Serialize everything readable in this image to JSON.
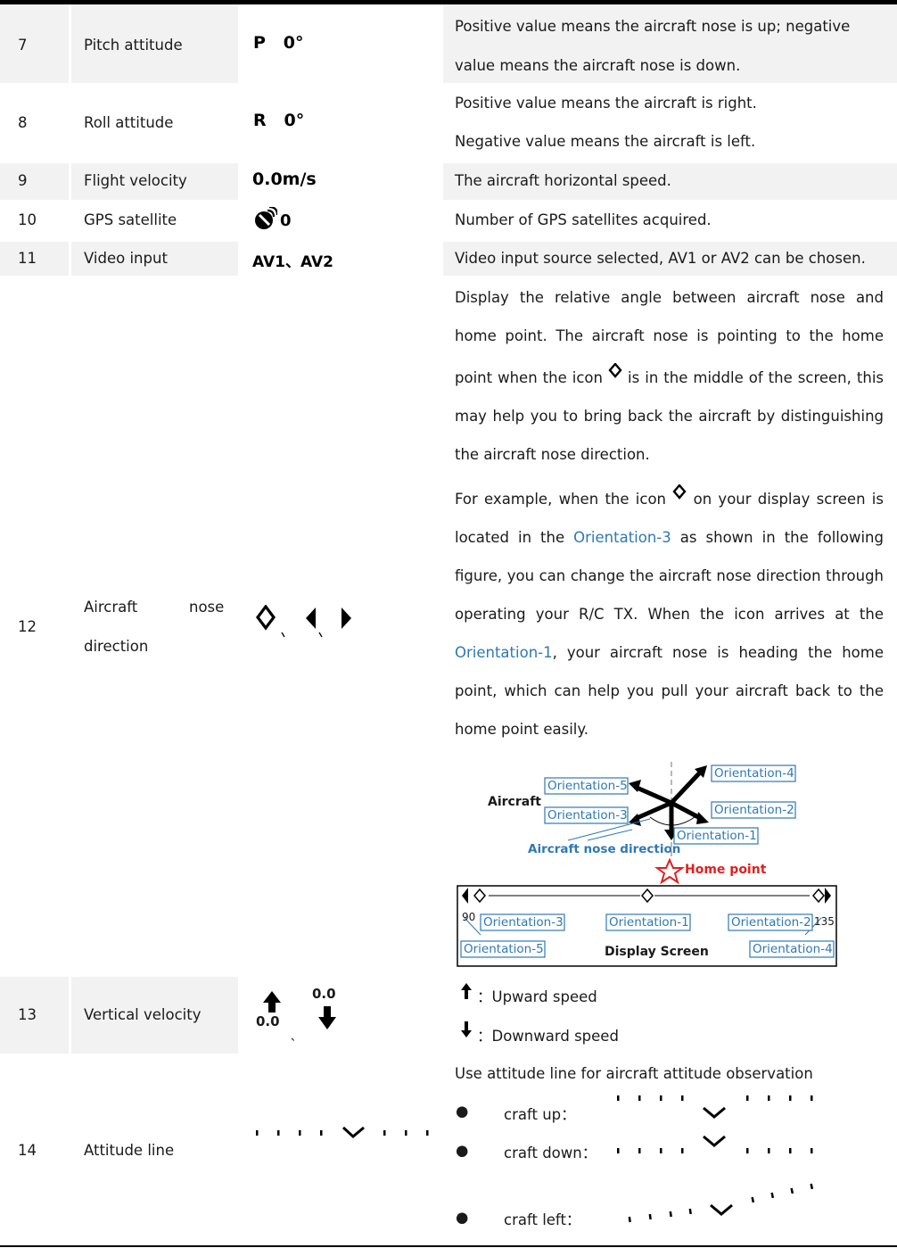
{
  "rows": [
    {
      "num": "7",
      "name": "Pitch attitude",
      "symbol": "P   0°",
      "desc": [
        "Positive value means the aircraft nose is up; negative",
        "value means the aircraft nose is down."
      ]
    },
    {
      "num": "8",
      "name": "Roll attitude",
      "symbol": "R   0°",
      "desc": [
        "Positive value means the aircraft is right.",
        "Negative value means the aircraft is left."
      ]
    },
    {
      "num": "9",
      "name": "Flight velocity",
      "symbol": "0.0m/s",
      "desc": [
        "The aircraft horizontal speed."
      ]
    },
    {
      "num": "10",
      "name": "GPS satellite",
      "symbol": "0",
      "desc": [
        "Number of GPS satellites acquired."
      ]
    },
    {
      "num": "11",
      "name": "Video input",
      "symbol": "AV1、AV2",
      "desc": [
        "Video input source selected, AV1 or AV2 can be chosen."
      ]
    },
    {
      "num": "12",
      "name_a": "Aircraft",
      "name_b": "nose",
      "name_c": "direction",
      "p1": "Display the relative angle between aircraft nose and home point. The aircraft nose is pointing to the home point when the icon",
      "p1b": "is in the middle of the screen, this may help you to bring back the aircraft by distinguishing the aircraft nose direction.",
      "p2a": "For example, when the icon",
      "p2b": "on your display screen is located in the",
      "p2link": "Orientation-3",
      "p2c": "as shown in the following figure, you can change the aircraft nose direction through operating your R/C TX. When the icon arrives at the",
      "p2link2": "Orientation-1",
      "p2d": ", your aircraft nose is heading the home point, which can help you pull your aircraft back to the home point easily."
    },
    {
      "num": "13",
      "name": "Vertical velocity",
      "up_value": "0.0",
      "down_value": "0.0",
      "desc_up": "：Upward speed",
      "desc_down": "：Downward speed"
    },
    {
      "num": "14",
      "name": "Attitude line",
      "intro": "Use attitude line for aircraft attitude observation",
      "items": [
        "craft up：",
        "craft down：",
        "craft left："
      ]
    }
  ],
  "figure": {
    "aircraft_label": "Aircraft",
    "nose_label": "Aircraft nose direction",
    "home_label": "Home point",
    "o1": "Orientation-1",
    "o2": "Orientation-2",
    "o3": "Orientation-3",
    "o4": "Orientation-4",
    "o5": "Orientation-5",
    "screen_label": "Display Screen",
    "left_deg": "90",
    "right_deg": "135"
  },
  "colors": {
    "blue": "#2f78b5",
    "home_red": "#e02020",
    "row_alt": "#f2f2f2"
  }
}
